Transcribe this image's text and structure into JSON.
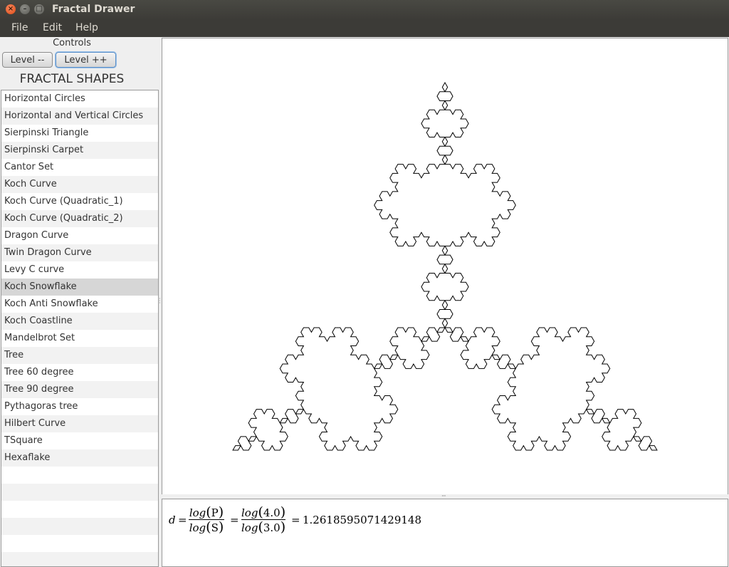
{
  "window": {
    "title": "Fractal Drawer",
    "close_glyph": "×",
    "min_glyph": "–",
    "max_glyph": "□"
  },
  "menubar": [
    "File",
    "Edit",
    "Help"
  ],
  "controls": {
    "label": "Controls",
    "level_down": "Level --",
    "level_up": "Level ++"
  },
  "shapes": {
    "title": "FRACTAL SHAPES",
    "selected": "Koch Snowflake",
    "items": [
      "Horizontal Circles",
      "Horizontal and Vertical Circles",
      "Sierpinski Triangle",
      "Sierpinski Carpet",
      "Cantor Set",
      "Koch Curve",
      "Koch Curve (Quadratic_1)",
      "Koch Curve (Quadratic_2)",
      "Dragon Curve",
      "Twin Dragon Curve",
      "Levy C curve",
      "Koch Snowflake",
      "Koch Anti Snowflake",
      "Koch Coastline",
      "Mandelbrot Set",
      "Tree",
      "Tree 60 degree",
      "Tree 90 degree",
      "Pythagoras tree",
      "Hilbert Curve",
      "TSquare",
      "Hexaflake"
    ]
  },
  "drawing": {
    "shape": "Koch Snowflake",
    "level": 4,
    "stroke_color": "#000000"
  },
  "formula": {
    "d": "d",
    "eq": "=",
    "num_func": "log",
    "num_arg": "P",
    "den_func": "log",
    "den_arg": "S",
    "num_value": "4.0",
    "den_value": "3.0",
    "result": "1.2618595071429148",
    "open_paren": "(",
    "close_paren": ")"
  }
}
